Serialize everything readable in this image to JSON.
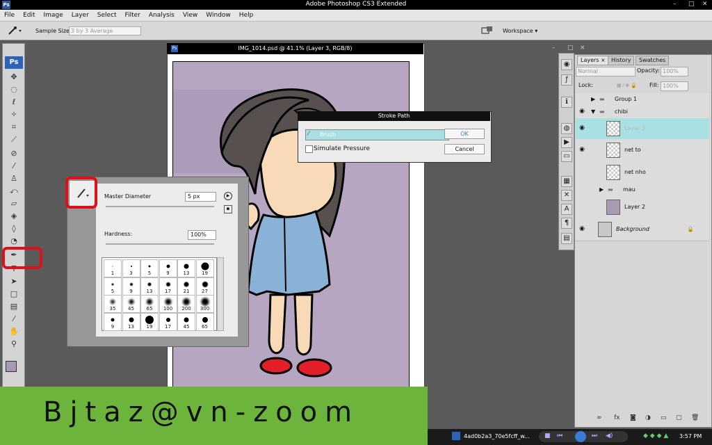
{
  "app": {
    "window_title": "Adobe Photoshop CS3 Extended",
    "logo": "Ps",
    "window_controls": [
      "–",
      "□",
      "✕"
    ]
  },
  "menu": [
    "File",
    "Edit",
    "Image",
    "Layer",
    "Select",
    "Filter",
    "Analysis",
    "View",
    "Window",
    "Help"
  ],
  "options": {
    "tool_icon": "eyedropper-icon",
    "sample_size_label": "Sample Size:",
    "sample_size_value": "3 by 3 Average",
    "workspace_label": "Workspace ▾"
  },
  "tools": {
    "logo": "Ps",
    "icons": [
      "move-icon",
      "marquee-icon",
      "lasso-icon",
      "magic-wand-icon",
      "crop-icon",
      "slice-icon",
      "healing-icon",
      "brush-icon",
      "stamp-icon",
      "history-brush-icon",
      "eraser-icon",
      "paint-bucket-icon",
      "blur-icon",
      "dodge-icon",
      "pen-icon",
      "type-icon",
      "path-select-icon",
      "shape-icon",
      "notes-icon",
      "eyedropper-tool-icon",
      "hand-icon",
      "zoom-icon"
    ],
    "foreground_color": "#a89ab3",
    "background_color": "#ffffff"
  },
  "document": {
    "title": "IMG_1014.psd @ 41.1% (Layer 3, RGB/8)",
    "controls": [
      "–",
      "□",
      "×"
    ],
    "canvas_color": "#b7a6c2"
  },
  "brush_panel": {
    "master_diameter_label": "Master Diameter",
    "master_diameter_value": "5 px",
    "hardness_label": "Hardness:",
    "hardness_value": "100%",
    "presets": [
      {
        "size": "1",
        "dot": 1
      },
      {
        "size": "3",
        "dot": 2
      },
      {
        "size": "5",
        "dot": 3
      },
      {
        "size": "9",
        "dot": 5
      },
      {
        "size": "13",
        "dot": 7
      },
      {
        "size": "19",
        "dot": 11
      },
      {
        "size": "5",
        "dot": 3
      },
      {
        "size": "9",
        "dot": 4
      },
      {
        "size": "13",
        "dot": 5
      },
      {
        "size": "17",
        "dot": 6
      },
      {
        "size": "21",
        "dot": 7
      },
      {
        "size": "27",
        "dot": 8
      },
      {
        "size": "35",
        "dot": 6
      },
      {
        "size": "45",
        "dot": 7
      },
      {
        "size": "65",
        "dot": 8
      },
      {
        "size": "100",
        "dot": 9
      },
      {
        "size": "200",
        "dot": 10
      },
      {
        "size": "300",
        "dot": 11
      },
      {
        "size": "9",
        "dot": 5
      },
      {
        "size": "13",
        "dot": 7
      },
      {
        "size": "19",
        "dot": 12
      },
      {
        "size": "17",
        "dot": 6
      },
      {
        "size": "45",
        "dot": 7
      },
      {
        "size": "65",
        "dot": 8
      }
    ]
  },
  "stroke_dialog": {
    "title": "Stroke Path",
    "tool_value": "Brush",
    "simulate_pressure": "Simulate Pressure",
    "ok": "OK",
    "cancel": "Cancel"
  },
  "layers_panel": {
    "tabs": [
      "Layers ×",
      "History",
      "Swatches"
    ],
    "blend_mode": "Normal",
    "opacity_label": "Opacity:",
    "opacity_value": "100%",
    "lock_label": "Lock:",
    "fill_label": "Fill:",
    "fill_value": "100%",
    "layers": [
      {
        "name": "Group 1",
        "kind": "group",
        "visible": false,
        "expanded": false,
        "indent": 0
      },
      {
        "name": "chibi",
        "kind": "group",
        "visible": true,
        "expanded": true,
        "indent": 0
      },
      {
        "name": "Layer 3",
        "kind": "layer",
        "visible": true,
        "selected": true,
        "indent": 1
      },
      {
        "name": "net to",
        "kind": "layer",
        "visible": true,
        "indent": 1
      },
      {
        "name": "net nho",
        "kind": "layer",
        "visible": false,
        "indent": 1
      },
      {
        "name": "mau",
        "kind": "group",
        "visible": false,
        "expanded": false,
        "indent": 1
      },
      {
        "name": "Layer 2",
        "kind": "layer",
        "visible": false,
        "indent": 1
      },
      {
        "name": "Background",
        "kind": "background",
        "visible": true,
        "indent": 0
      }
    ],
    "footer_icons": [
      "link-icon",
      "fx-icon",
      "mask-icon",
      "adjustment-icon",
      "folder-icon",
      "new-layer-icon",
      "trash-icon"
    ]
  },
  "taskbar": {
    "item": "4ad0b2a3_70e5fcff_w...",
    "clock": "3:57 PM"
  },
  "banner": {
    "text": "Bjtaz@vn-zoom",
    "color": "#6cb43c"
  }
}
